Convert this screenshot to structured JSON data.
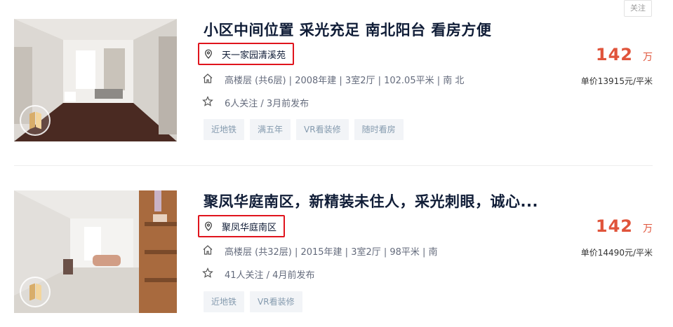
{
  "follow_button": {
    "label": "关注"
  },
  "listings": [
    {
      "title": "小区中间位置 采光充足 南北阳台 看房方便",
      "community": "天一家园清溪苑",
      "house_info": "高楼层 (共6层) | 2008年建 | 3室2厅 | 102.05平米 | 南 北",
      "follow_info": "6人关注 / 3月前发布",
      "tags": [
        "近地铁",
        "满五年",
        "VR看装修",
        "随时看房"
      ],
      "price": "142",
      "price_unit": "万",
      "unit_price": "单价13915元/平米"
    },
    {
      "title": "聚凤华庭南区，新精装未住人，采光刺眼，诚心...",
      "community": "聚凤华庭南区",
      "house_info": "高楼层 (共32层) | 2015年建 | 3室2厅 | 98平米 | 南",
      "follow_info": "41人关注 / 4月前发布",
      "tags": [
        "近地铁",
        "VR看装修"
      ],
      "price": "142",
      "price_unit": "万",
      "unit_price": "单价14490元/平米"
    }
  ],
  "colors": {
    "price": "#e0543b",
    "highlight_border": "#e0141d",
    "title": "#101d37",
    "tag_bg": "#f2f4f7",
    "tag_text": "#849aae"
  },
  "icons": {
    "location": "map-pin-icon",
    "house": "house-icon",
    "star": "star-icon",
    "vr": "vr-badge-icon"
  }
}
